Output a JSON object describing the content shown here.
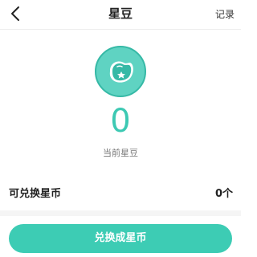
{
  "header": {
    "title": "星豆",
    "record_link": "记录"
  },
  "balance": {
    "value": "0",
    "label": "当前星豆"
  },
  "redeemable": {
    "label": "可兑换星币",
    "value": "0个"
  },
  "cta": {
    "label": "兑换成星币"
  },
  "colors": {
    "accent": "#3dc9b3",
    "button": "#3dccb4"
  },
  "icons": {
    "back": "chevron-left-icon",
    "bean": "star-bean-icon"
  }
}
